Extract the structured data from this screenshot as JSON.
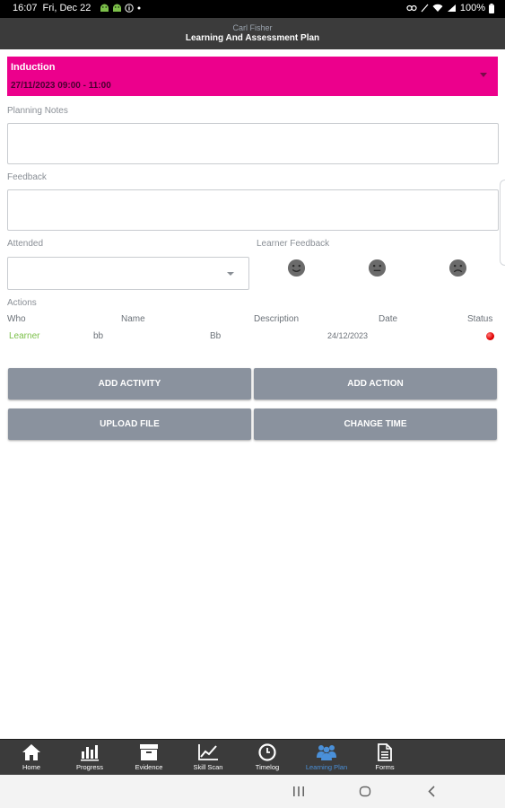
{
  "status_bar": {
    "time": "16:07",
    "date": "Fri, Dec 22",
    "battery": "100%"
  },
  "header": {
    "user_name": "Carl Fisher",
    "title": "Learning And Assessment Plan"
  },
  "session": {
    "title": "Induction",
    "datetime": "27/11/2023 09:00 - 11:00",
    "color": "#ec008c"
  },
  "form": {
    "planning_notes_label": "Planning Notes",
    "planning_notes_value": "",
    "feedback_label": "Feedback",
    "feedback_value": "",
    "attended_label": "Attended",
    "attended_value": "",
    "learner_feedback_label": "Learner Feedback",
    "faces": [
      "happy-face-icon",
      "neutral-face-icon",
      "sad-face-icon"
    ]
  },
  "actions": {
    "label": "Actions",
    "columns": [
      "Who",
      "Name",
      "Description",
      "Date",
      "Status"
    ],
    "rows": [
      {
        "who": "Learner",
        "name": "bb",
        "description": "Bb",
        "date": "24/12/2023",
        "status": "red"
      }
    ]
  },
  "buttons": {
    "add_activity": "ADD ACTIVITY",
    "add_action": "ADD ACTION",
    "upload_file": "UPLOAD FILE",
    "change_time": "CHANGE TIME"
  },
  "tabs": [
    {
      "label": "Home",
      "icon": "home-icon"
    },
    {
      "label": "Progress",
      "icon": "bar-chart-icon"
    },
    {
      "label": "Evidence",
      "icon": "archive-box-icon"
    },
    {
      "label": "Skill Scan",
      "icon": "trend-line-icon"
    },
    {
      "label": "Timelog",
      "icon": "clock-icon"
    },
    {
      "label": "Learning Plan",
      "icon": "people-icon",
      "active": true
    },
    {
      "label": "Forms",
      "icon": "document-icon"
    }
  ],
  "colors": {
    "accent_active": "#4a90d9",
    "header_bg": "#3b3b3b",
    "button_bg": "#8a929e",
    "learner_text": "#7cc04a",
    "status_red": "#e10000"
  }
}
